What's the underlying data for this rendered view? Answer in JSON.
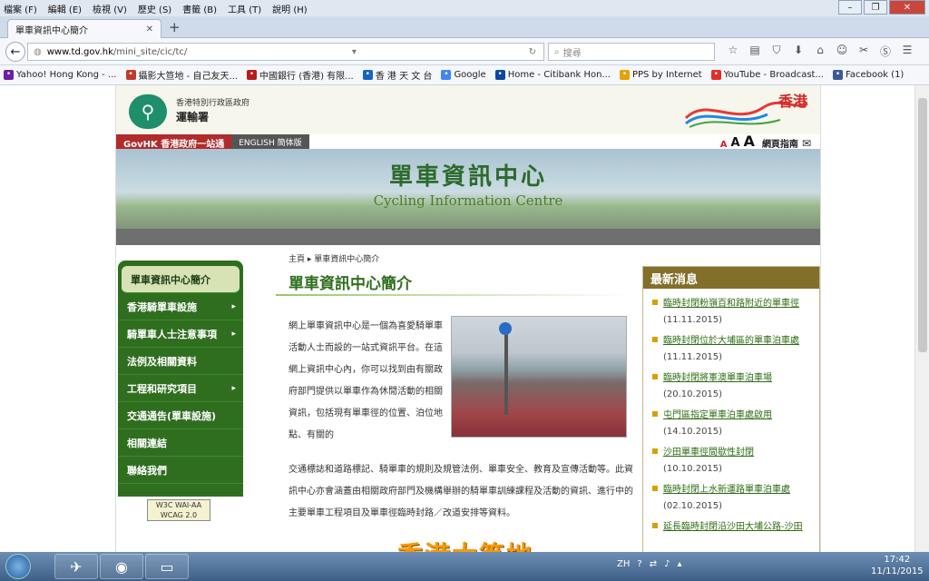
{
  "browser": {
    "menu": [
      "檔案 (F)",
      "編輯 (E)",
      "檢視 (V)",
      "歷史 (S)",
      "書籤 (B)",
      "工具 (T)",
      "說明 (H)"
    ],
    "tab_title": "單車資訊中心簡介",
    "url_host": "www.td.gov.hk",
    "url_path": "/mini_site/cic/tc/",
    "search_placeholder": "搜尋",
    "bookmarks": [
      {
        "label": "Yahoo! Hong Kong - ...",
        "icon": "yahoo-icon",
        "color": "#6d1fa6"
      },
      {
        "label": "攝影大笪地 - 自己友天...",
        "icon": "camera-icon",
        "color": "#c0392b"
      },
      {
        "label": "中國銀行 (香港) 有限...",
        "icon": "bank-icon",
        "color": "#b71c1c"
      },
      {
        "label": "香 港 天 文 台",
        "icon": "weather-icon",
        "color": "#1565c0"
      },
      {
        "label": "Google",
        "icon": "google-icon",
        "color": "#4285f4"
      },
      {
        "label": "Home - Citibank Hon...",
        "icon": "citi-icon",
        "color": "#0d47a1"
      },
      {
        "label": "PPS by Internet",
        "icon": "pps-icon",
        "color": "#e6a100"
      },
      {
        "label": "YouTube - Broadcast...",
        "icon": "youtube-icon",
        "color": "#e52d27"
      },
      {
        "label": "Facebook (1)",
        "icon": "facebook-icon",
        "color": "#3b5998"
      }
    ]
  },
  "site": {
    "dept_line1": "香港特別行政區政府",
    "dept_line2": "運輸署",
    "brand": "香港",
    "govhk": "GovHK 香港政府一站通",
    "lang_links": "ENGLISH 簡体版",
    "font_sizes": [
      "A",
      "A",
      "A"
    ],
    "sitemap": "網頁指南",
    "banner_title_zh": "單車資訊中心",
    "banner_title_en": "Cycling Information Centre",
    "breadcrumb": "主頁 ▸ 單車資訊中心簡介",
    "page_title": "單車資訊中心簡介",
    "intro_top": "網上單車資訊中心是一個為喜愛騎單車活動人士而設的一站式資訊平台。在這網上資訊中心內，你可以找到由有關政府部門提供以單車作為休閒活動的相關資訊，包括現有單車徑的位置、泊位地點、有關的",
    "intro_bottom": "交通標誌和道路標記、騎單車的規則及規管法例、單車安全、教育及宣傳活動等。此資訊中心亦會涵蓋由相關政府部門及機構舉辦的騎單車訓練課程及活動的資訊、進行中的主要單車工程項目及單車徑臨時封路／改道安排等資料。",
    "w3c_badge": "W3C WAI-AA WCAG 2.0"
  },
  "sidebar": [
    {
      "label": "單車資訊中心簡介",
      "arrow": ""
    },
    {
      "label": "香港騎單車設施",
      "arrow": "▸"
    },
    {
      "label": "騎單車人士注意事項",
      "arrow": "▸"
    },
    {
      "label": "法例及相關資料",
      "arrow": ""
    },
    {
      "label": "工程和研究項目",
      "arrow": "▸"
    },
    {
      "label": "交通通告(單車設施)",
      "arrow": ""
    },
    {
      "label": "相關連結",
      "arrow": ""
    },
    {
      "label": "聯絡我們",
      "arrow": ""
    }
  ],
  "news": {
    "heading": "最新消息",
    "items": [
      {
        "title": "臨時封閉粉嶺百和路附近的單車徑",
        "date": "(11.11.2015)"
      },
      {
        "title": "臨時封閉位於大埔區的單車泊車處",
        "date": "(11.11.2015)"
      },
      {
        "title": "臨時封閉將軍澳單車泊車場",
        "date": "(20.10.2015)"
      },
      {
        "title": "屯門區指定單車泊車處啟用",
        "date": "(14.10.2015)"
      },
      {
        "title": "沙田單車徑間歇性封閉",
        "date": "(10.10.2015)"
      },
      {
        "title": "臨時封閉上水新運路單車泊車處",
        "date": "(02.10.2015)"
      },
      {
        "title": "延長臨時封閉沿沙田大埔公路-沙田",
        "date": ""
      }
    ]
  },
  "overlay": {
    "watermark": "香港大笪地"
  },
  "taskbar": {
    "lang": "ZH",
    "time": "17:42",
    "date": "11/11/2015"
  }
}
